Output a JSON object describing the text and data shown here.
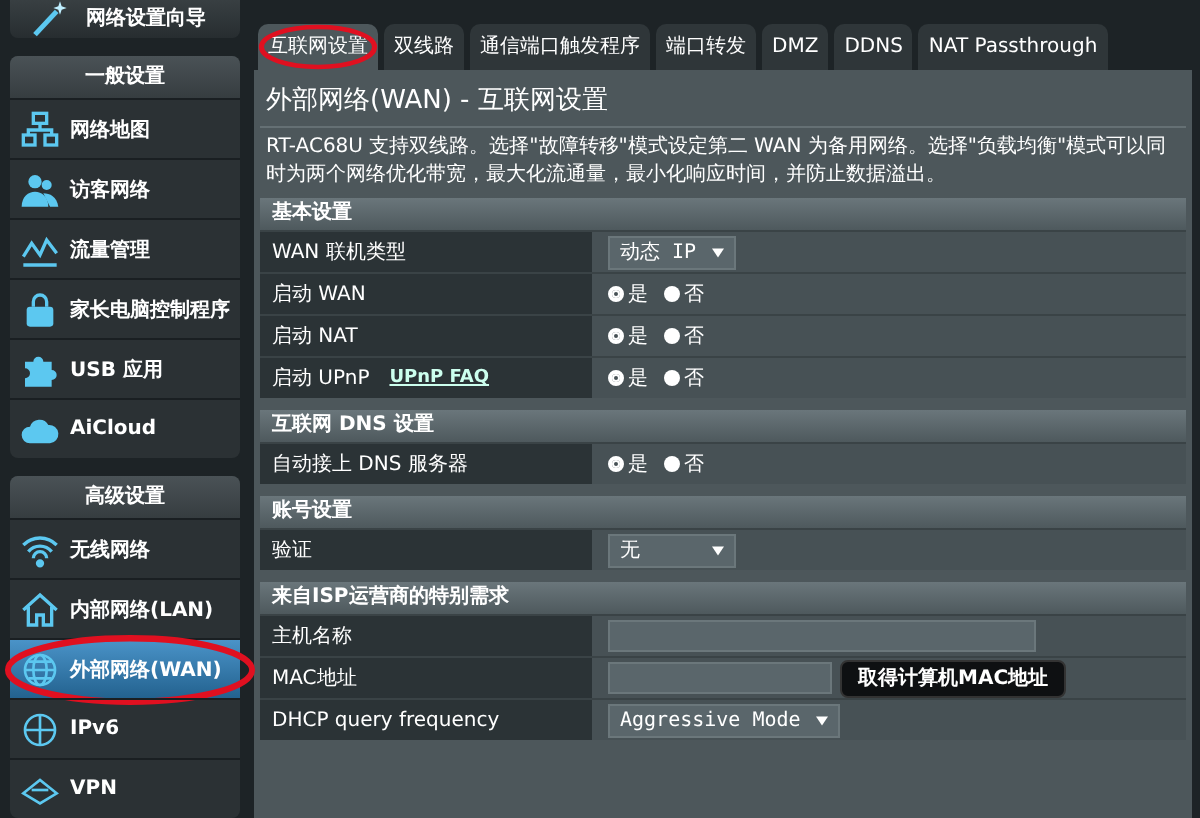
{
  "sidebar": {
    "wizard": "网络设置向导",
    "groups": [
      {
        "title": "一般设置",
        "items": [
          {
            "label": "网络地图",
            "selected": false,
            "circled": false
          },
          {
            "label": "访客网络",
            "selected": false,
            "circled": false
          },
          {
            "label": "流量管理",
            "selected": false,
            "circled": false
          },
          {
            "label": "家长电脑控制程序",
            "selected": false,
            "circled": false
          },
          {
            "label": "USB 应用",
            "selected": false,
            "circled": false
          },
          {
            "label": "AiCloud",
            "selected": false,
            "circled": false
          }
        ]
      },
      {
        "title": "高级设置",
        "items": [
          {
            "label": "无线网络",
            "selected": false,
            "circled": false
          },
          {
            "label": "内部网络(LAN)",
            "selected": false,
            "circled": false
          },
          {
            "label": "外部网络(WAN)",
            "selected": true,
            "circled": true
          },
          {
            "label": "IPv6",
            "selected": false,
            "circled": false
          },
          {
            "label": "VPN",
            "selected": false,
            "circled": false
          }
        ]
      }
    ]
  },
  "tabs": [
    {
      "label": "互联网设置",
      "selected": true,
      "circled": true
    },
    {
      "label": "双线路",
      "selected": false,
      "circled": false
    },
    {
      "label": "通信端口触发程序",
      "selected": false,
      "circled": false
    },
    {
      "label": "端口转发",
      "selected": false,
      "circled": false
    },
    {
      "label": "DMZ",
      "selected": false,
      "circled": false
    },
    {
      "label": "DDNS",
      "selected": false,
      "circled": false
    },
    {
      "label": "NAT Passthrough",
      "selected": false,
      "circled": false
    }
  ],
  "page_title": "外部网络(WAN) - 互联网设置",
  "description": "RT-AC68U 支持双线路。选择\"故障转移\"模式设定第二 WAN 为备用网络。选择\"负载均衡\"模式可以同时为两个网络优化带宽，最大化流通量，最小化响应时间，并防止数据溢出。",
  "sections": [
    {
      "title": "基本设置",
      "rows": [
        {
          "label": "WAN 联机类型",
          "kind": "select",
          "value": "动态 IP"
        },
        {
          "label": "启动 WAN",
          "kind": "radio",
          "options": [
            {
              "label": "是",
              "selected": true
            },
            {
              "label": "否",
              "selected": false
            }
          ]
        },
        {
          "label": "启动 NAT",
          "kind": "radio",
          "options": [
            {
              "label": "是",
              "selected": true
            },
            {
              "label": "否",
              "selected": false
            }
          ]
        },
        {
          "label": "启动 UPnP",
          "link": "UPnP  FAQ",
          "kind": "radio",
          "options": [
            {
              "label": "是",
              "selected": true
            },
            {
              "label": "否",
              "selected": false
            }
          ]
        }
      ]
    },
    {
      "title": "互联网 DNS 设置",
      "rows": [
        {
          "label": "自动接上 DNS 服务器",
          "kind": "radio",
          "options": [
            {
              "label": "是",
              "selected": true
            },
            {
              "label": "否",
              "selected": false
            }
          ]
        }
      ]
    },
    {
      "title": "账号设置",
      "rows": [
        {
          "label": "验证",
          "kind": "select",
          "value": "无"
        }
      ]
    },
    {
      "title": "来自ISP运营商的特别需求",
      "rows": [
        {
          "label": "主机名称",
          "kind": "text"
        },
        {
          "label": "MAC地址",
          "kind": "text_button",
          "button": "取得计算机MAC地址"
        },
        {
          "label": "DHCP query frequency",
          "kind": "select",
          "value": "Aggressive Mode"
        }
      ]
    }
  ]
}
